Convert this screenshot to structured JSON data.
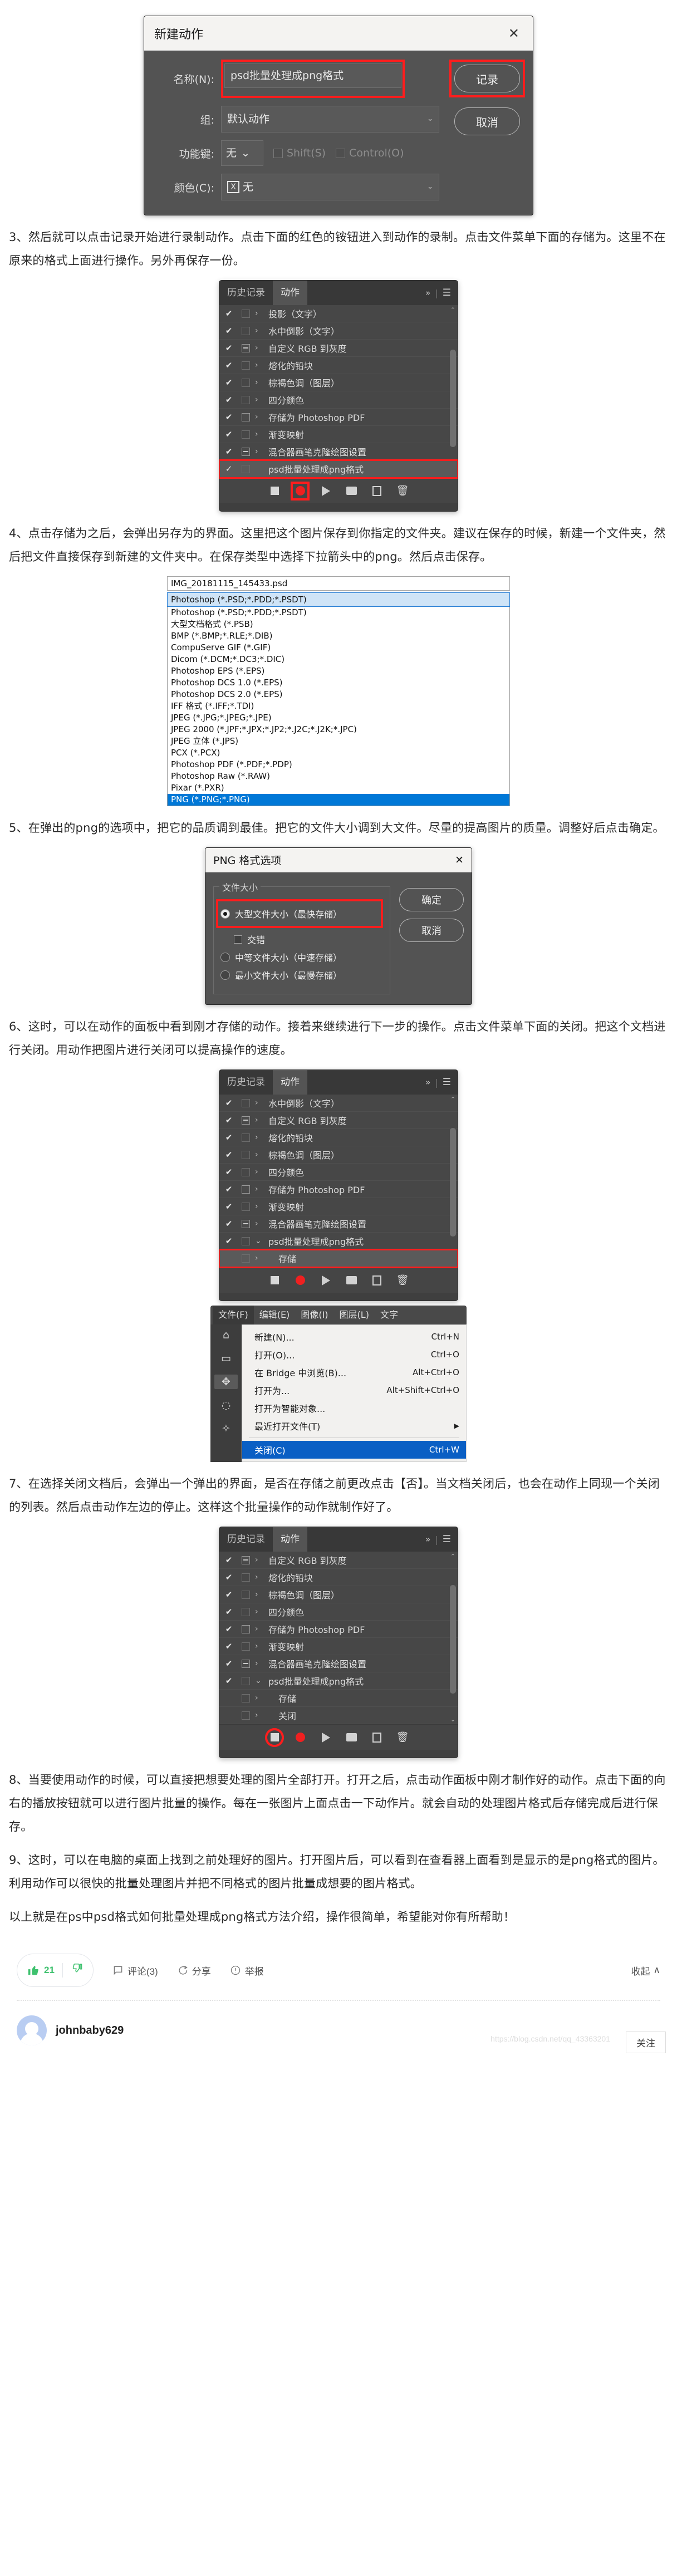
{
  "new_action_dialog": {
    "title": "新建动作",
    "close_icon": "✕",
    "name_label": "名称(N):",
    "name_value": "psd批量处理成png格式",
    "group_label": "组:",
    "group_value": "默认动作",
    "fkey_label": "功能键:",
    "fkey_value": "无",
    "shift_label": "Shift(S)",
    "control_label": "Control(O)",
    "color_label": "颜色(C):",
    "color_value": "无",
    "color_swatch": "X",
    "record_button": "记录",
    "cancel_button": "取消",
    "highlight_color": "#ff1d1d"
  },
  "para3": "3、然后就可以点击记录开始进行录制动作。点击下面的红色的铵钮进入到动作的录制。点击文件菜单下面的存储为。这里不在原来的格式上面进行操作。另外再保存一份。",
  "actions_panel_1": {
    "tab_history": "历史记录",
    "tab_actions": "动作",
    "chevrons_icon": "»",
    "menu_icon": "☰",
    "rows": [
      {
        "check": "✔",
        "box": "blank",
        "arrow": "›",
        "name": "投影（文字）",
        "selected": false
      },
      {
        "check": "✔",
        "box": "blank",
        "arrow": "›",
        "name": "水中倒影（文字）",
        "selected": false
      },
      {
        "check": "✔",
        "box": "minus",
        "arrow": "›",
        "name": "自定义 RGB 到灰度",
        "selected": false
      },
      {
        "check": "✔",
        "box": "blank",
        "arrow": "›",
        "name": "熔化的铅块",
        "selected": false
      },
      {
        "check": "✔",
        "box": "blank",
        "arrow": "›",
        "name": "棕褐色调（图层）",
        "selected": false
      },
      {
        "check": "✔",
        "box": "blank",
        "arrow": "›",
        "name": "四分颜色",
        "selected": false
      },
      {
        "check": "✔",
        "box": "empty",
        "arrow": "›",
        "name": "存储为 Photoshop PDF",
        "selected": false
      },
      {
        "check": "✔",
        "box": "blank",
        "arrow": "›",
        "name": "渐变映射",
        "selected": false
      },
      {
        "check": "✔",
        "box": "minus",
        "arrow": "›",
        "name": "混合器画笔克隆绘图设置",
        "selected": false
      },
      {
        "check": "✓",
        "box": "blank",
        "arrow": "",
        "name": "psd批量处理成png格式",
        "selected": true
      }
    ],
    "footer_icons": [
      "stop-icon",
      "record-icon",
      "play-icon",
      "folder-icon",
      "new-action-icon",
      "trash-icon"
    ]
  },
  "para4": "4、点击存储为之后，会弹出另存为的界面。这里把这个图片保存到你指定的文件夹。建议在保存的时候，新建一个文件夹，然后把文件直接保存到新建的文件夹中。在保存类型中选择下拉箭头中的png。然后点击保存。",
  "format_list": {
    "filename": "IMG_20181115_145433.psd",
    "selected_value": "Photoshop (*.PSD;*.PDD;*.PSDT)",
    "items": [
      "Photoshop (*.PSD;*.PDD;*.PSDT)",
      "大型文档格式 (*.PSB)",
      "BMP (*.BMP;*.RLE;*.DIB)",
      "CompuServe GIF (*.GIF)",
      "Dicom (*.DCM;*.DC3;*.DIC)",
      "Photoshop EPS (*.EPS)",
      "Photoshop DCS 1.0 (*.EPS)",
      "Photoshop DCS 2.0 (*.EPS)",
      "IFF 格式 (*.IFF;*.TDI)",
      "JPEG (*.JPG;*.JPEG;*.JPE)",
      "JPEG 2000 (*.JPF;*.JPX;*.JP2;*.J2C;*.J2K;*.JPC)",
      "JPEG 立体 (*.JPS)",
      "PCX (*.PCX)",
      "Photoshop PDF (*.PDF;*.PDP)",
      "Photoshop Raw (*.RAW)",
      "Pixar (*.PXR)",
      "PNG (*.PNG;*.PNG)"
    ],
    "highlighted_item": "PNG (*.PNG;*.PNG)"
  },
  "para5": "5、在弹出的png的选项中，把它的品质调到最佳。把它的文件大小调到大文件。尽量的提高图片的质量。调整好后点击确定。",
  "png_dialog": {
    "title": "PNG 格式选项",
    "close_icon": "✕",
    "group_legend": "文件大小",
    "options": [
      {
        "label": "大型文件大小（最快存储）",
        "selected": true,
        "highlighted": true
      },
      {
        "label": "中等文件大小（中速存储）",
        "selected": false,
        "highlighted": false
      },
      {
        "label": "最小文件大小（最慢存储）",
        "selected": false,
        "highlighted": false
      }
    ],
    "interlace_label": "交错",
    "ok_button": "确定",
    "cancel_button": "取消"
  },
  "para6": "6、这时，可以在动作的面板中看到刚才存储的动作。接着来继续进行下一步的操作。点击文件菜单下面的关闭。把这个文档进行关闭。用动作把图片进行关闭可以提高操作的速度。",
  "actions_panel_2": {
    "tab_history": "历史记录",
    "tab_actions": "动作",
    "chevrons_icon": "»",
    "menu_icon": "☰",
    "rows": [
      {
        "check": "✔",
        "box": "blank",
        "arrow": "›",
        "name": "水中倒影（文字）",
        "selected": false,
        "indent": false
      },
      {
        "check": "✔",
        "box": "minus",
        "arrow": "›",
        "name": "自定义 RGB 到灰度",
        "selected": false,
        "indent": false
      },
      {
        "check": "✔",
        "box": "blank",
        "arrow": "›",
        "name": "熔化的铅块",
        "selected": false,
        "indent": false
      },
      {
        "check": "✔",
        "box": "blank",
        "arrow": "›",
        "name": "棕褐色调（图层）",
        "selected": false,
        "indent": false
      },
      {
        "check": "✔",
        "box": "blank",
        "arrow": "›",
        "name": "四分颜色",
        "selected": false,
        "indent": false
      },
      {
        "check": "✔",
        "box": "empty",
        "arrow": "›",
        "name": "存储为 Photoshop PDF",
        "selected": false,
        "indent": false
      },
      {
        "check": "✔",
        "box": "blank",
        "arrow": "›",
        "name": "渐变映射",
        "selected": false,
        "indent": false
      },
      {
        "check": "✔",
        "box": "minus",
        "arrow": "›",
        "name": "混合器画笔克隆绘图设置",
        "selected": false,
        "indent": false
      },
      {
        "check": "✔",
        "box": "blank",
        "arrow": "⌄",
        "name": "psd批量处理成png格式",
        "selected": false,
        "indent": false
      },
      {
        "check": "",
        "box": "blank",
        "arrow": "›",
        "name": "存储",
        "selected": true,
        "indent": true
      }
    ]
  },
  "file_menu": {
    "menubar": [
      "文件(F)",
      "编辑(E)",
      "图像(I)",
      "图层(L)",
      "文字"
    ],
    "active_menu": "文件(F)",
    "items": [
      {
        "label": "新建(N)...",
        "key": "Ctrl+N",
        "highlighted": false,
        "submenu": false
      },
      {
        "label": "打开(O)...",
        "key": "Ctrl+O",
        "highlighted": false,
        "submenu": false
      },
      {
        "label": "在 Bridge 中浏览(B)...",
        "key": "Alt+Ctrl+O",
        "highlighted": false,
        "submenu": false
      },
      {
        "label": "打开为...",
        "key": "Alt+Shift+Ctrl+O",
        "highlighted": false,
        "submenu": false
      },
      {
        "label": "打开为智能对象...",
        "key": "",
        "highlighted": false,
        "submenu": false
      },
      {
        "label": "最近打开文件(T)",
        "key": "",
        "highlighted": false,
        "submenu": true
      }
    ],
    "close_item": {
      "label": "关闭(C)",
      "key": "Ctrl+W",
      "highlighted": true
    }
  },
  "para7": "7、在选择关闭文档后，会弹出一个弹出的界面，是否在存储之前更改点击【否】。当文档关闭后，也会在动作上同现一个关闭的列表。然后点击动作左边的停止。这样这个批量操作的动作就制作好了。",
  "actions_panel_3": {
    "tab_history": "历史记录",
    "tab_actions": "动作",
    "chevrons_icon": "»",
    "menu_icon": "☰",
    "rows": [
      {
        "check": "✔",
        "box": "minus",
        "arrow": "›",
        "name": "自定义 RGB 到灰度",
        "selected": false,
        "indent": false
      },
      {
        "check": "✔",
        "box": "blank",
        "arrow": "›",
        "name": "熔化的铅块",
        "selected": false,
        "indent": false
      },
      {
        "check": "✔",
        "box": "blank",
        "arrow": "›",
        "name": "棕褐色调（图层）",
        "selected": false,
        "indent": false
      },
      {
        "check": "✔",
        "box": "blank",
        "arrow": "›",
        "name": "四分颜色",
        "selected": false,
        "indent": false
      },
      {
        "check": "✔",
        "box": "empty",
        "arrow": "›",
        "name": "存储为 Photoshop PDF",
        "selected": false,
        "indent": false
      },
      {
        "check": "✔",
        "box": "blank",
        "arrow": "›",
        "name": "渐变映射",
        "selected": false,
        "indent": false
      },
      {
        "check": "✔",
        "box": "minus",
        "arrow": "›",
        "name": "混合器画笔克隆绘图设置",
        "selected": false,
        "indent": false
      },
      {
        "check": "✔",
        "box": "blank",
        "arrow": "⌄",
        "name": "psd批量处理成png格式",
        "selected": false,
        "indent": false
      },
      {
        "check": "",
        "box": "blank",
        "arrow": "›",
        "name": "存储",
        "selected": false,
        "indent": true
      },
      {
        "check": "",
        "box": "blank",
        "arrow": "›",
        "name": "关闭",
        "selected": false,
        "indent": true
      }
    ]
  },
  "para8": "8、当要使用动作的时候，可以直接把想要处理的图片全部打开。打开之后，点击动作面板中刚才制作好的动作。点击下面的向右的播放按钮就可以进行图片批量的操作。每在一张图片上面点击一下动作片。就会自动的处理图片格式后存储完成后进行保存。",
  "para9": "9、这时，可以在电脑的桌面上找到之前处理好的图片。打开图片后，可以看到在查看器上面看到是显示的是png格式的图片。利用动作可以很快的批量处理图片并把不同格式的图片批量成想要的图片格式。",
  "para10": "以上就是在ps中psd格式如何批量处理成png格式方法介绍，操作很简单，希望能对你有所帮助！",
  "footer": {
    "like_icon": "👍",
    "like_count": "21",
    "dislike_icon": "👎",
    "comment_icon": "comment-icon",
    "comment_label": "评论(3)",
    "share_icon": "share-icon",
    "share_label": "分享",
    "report_icon": "report-icon",
    "report_label": "举报",
    "collapse_label": "收起",
    "collapse_icon": "∧",
    "author_name": "johnbaby629",
    "watermark": "https://blog.csdn.net/qq_43363201",
    "follow_label": "关注"
  }
}
